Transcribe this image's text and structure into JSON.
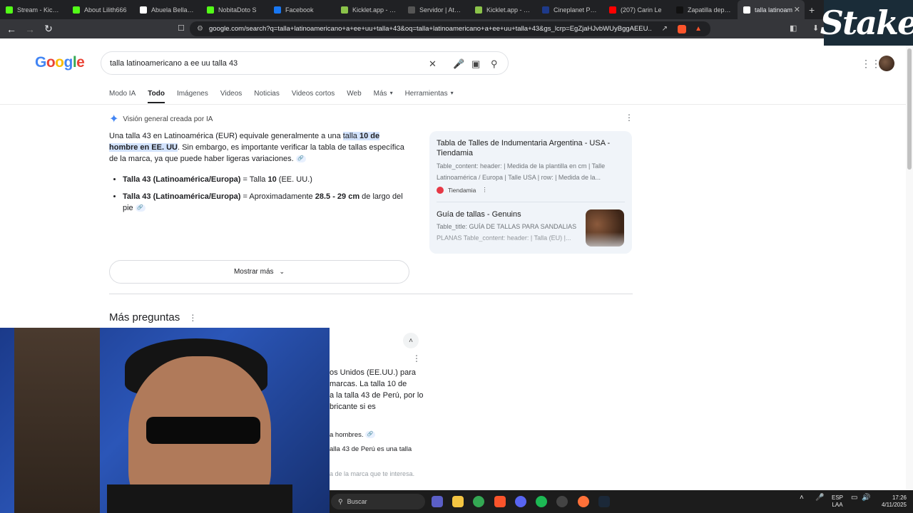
{
  "browser": {
    "tabs": [
      {
        "label": "Stream - Kick Das",
        "icon": "kick-icon",
        "color": "#53fc18"
      },
      {
        "label": "About Lilith666",
        "icon": "kick-icon",
        "color": "#53fc18"
      },
      {
        "label": "Abuela Bellaca: El",
        "icon": "tiktok-icon",
        "color": "#ffffff"
      },
      {
        "label": "NobitaDoto S",
        "icon": "kick-icon",
        "color": "#53fc18"
      },
      {
        "label": "Facebook",
        "icon": "meta-icon",
        "color": "#1877f2"
      },
      {
        "label": "Kicklet.app - Kick",
        "icon": "kicklet-icon",
        "color": "#8bc34a"
      },
      {
        "label": "Servidor | Aternos",
        "icon": "aternos-icon",
        "color": "#555555"
      },
      {
        "label": "Kicklet.app - Kick",
        "icon": "kicklet-icon",
        "color": "#8bc34a"
      },
      {
        "label": "Cineplanet Perú",
        "icon": "cineplanet-icon",
        "color": "#1e3a8a"
      },
      {
        "label": "(207) Carin Le",
        "icon": "youtube-icon",
        "color": "#ff0000"
      },
      {
        "label": "Zapatilla deporti",
        "icon": "brand-icon",
        "color": "#111111"
      },
      {
        "label": "talla latinoam",
        "icon": "google-icon",
        "color": "#ffffff"
      }
    ],
    "url": "google.com/search?q=talla+latinoamericano+a+ee+uu+talla+43&oq=talla+latinoamericano+a+ee+uu+talla+43&gs_lcrp=EgZjaHJvbWUyBggAEEU..."
  },
  "overlay": {
    "stake_logo": "Stake"
  },
  "google": {
    "logo": "Google",
    "query": "talla latinoamericano a ee uu talla 43",
    "nav_tabs": [
      "Modo IA",
      "Todo",
      "Imágenes",
      "Videos",
      "Noticias",
      "Videos cortos",
      "Web",
      "Más",
      "Herramientas"
    ],
    "active_tab": "Todo"
  },
  "ai_overview": {
    "header": "Visión general creada por IA",
    "para_pre": "Una talla 43 en Latinoamérica (EUR) equivale generalmente a una ",
    "para_hl_a": "talla ",
    "para_hl_b": "10 de hombre en EE. UU",
    "para_post": ". Sin embargo, es importante verificar la tabla de tallas específica de la marca, ya que puede haber ligeras variaciones.",
    "b1_bold": "Talla 43 (Latinoamérica/Europa)",
    "b1_mid": " = Talla ",
    "b1_bold2": "10",
    "b1_end": " (EE. UU.)",
    "b2_bold": "Talla 43 (Latinoamérica/Europa)",
    "b2_mid": " = Aproximadamente ",
    "b2_bold2": "28.5 - 29 cm",
    "b2_end": " de largo del pie",
    "show_more": "Mostrar más"
  },
  "sources": [
    {
      "title": "Tabla de Talles de Indumentaria Argentina - USA - Tiendamia",
      "desc": "Table_content: header: | Medida de la plantilla en cm | Talle Latinoamérica / Europa | Talle USA | row: | Medida de la...",
      "site": "Tiendamia"
    },
    {
      "title": "Guía de tallas - Genuins",
      "desc": "Table_title: GUÍA DE TALLAS PARA SANDALIAS PLANAS Table_content: header: | Talla (EU) |..."
    }
  ],
  "more_questions": {
    "title": "Más preguntas",
    "lines": [
      "os Unidos (EE.UU.) para",
      "marcas. La talla 10 de",
      "a la talla 43 de Perú, por lo",
      "bricante si es",
      "a hombres.",
      "alla 43 de Perú es una talla",
      "a de la marca que te interesa."
    ]
  },
  "taskbar": {
    "search": "Buscar",
    "lang": "ESP",
    "lang2": "LAA",
    "time": "17:26",
    "date": "4/11/2025"
  }
}
